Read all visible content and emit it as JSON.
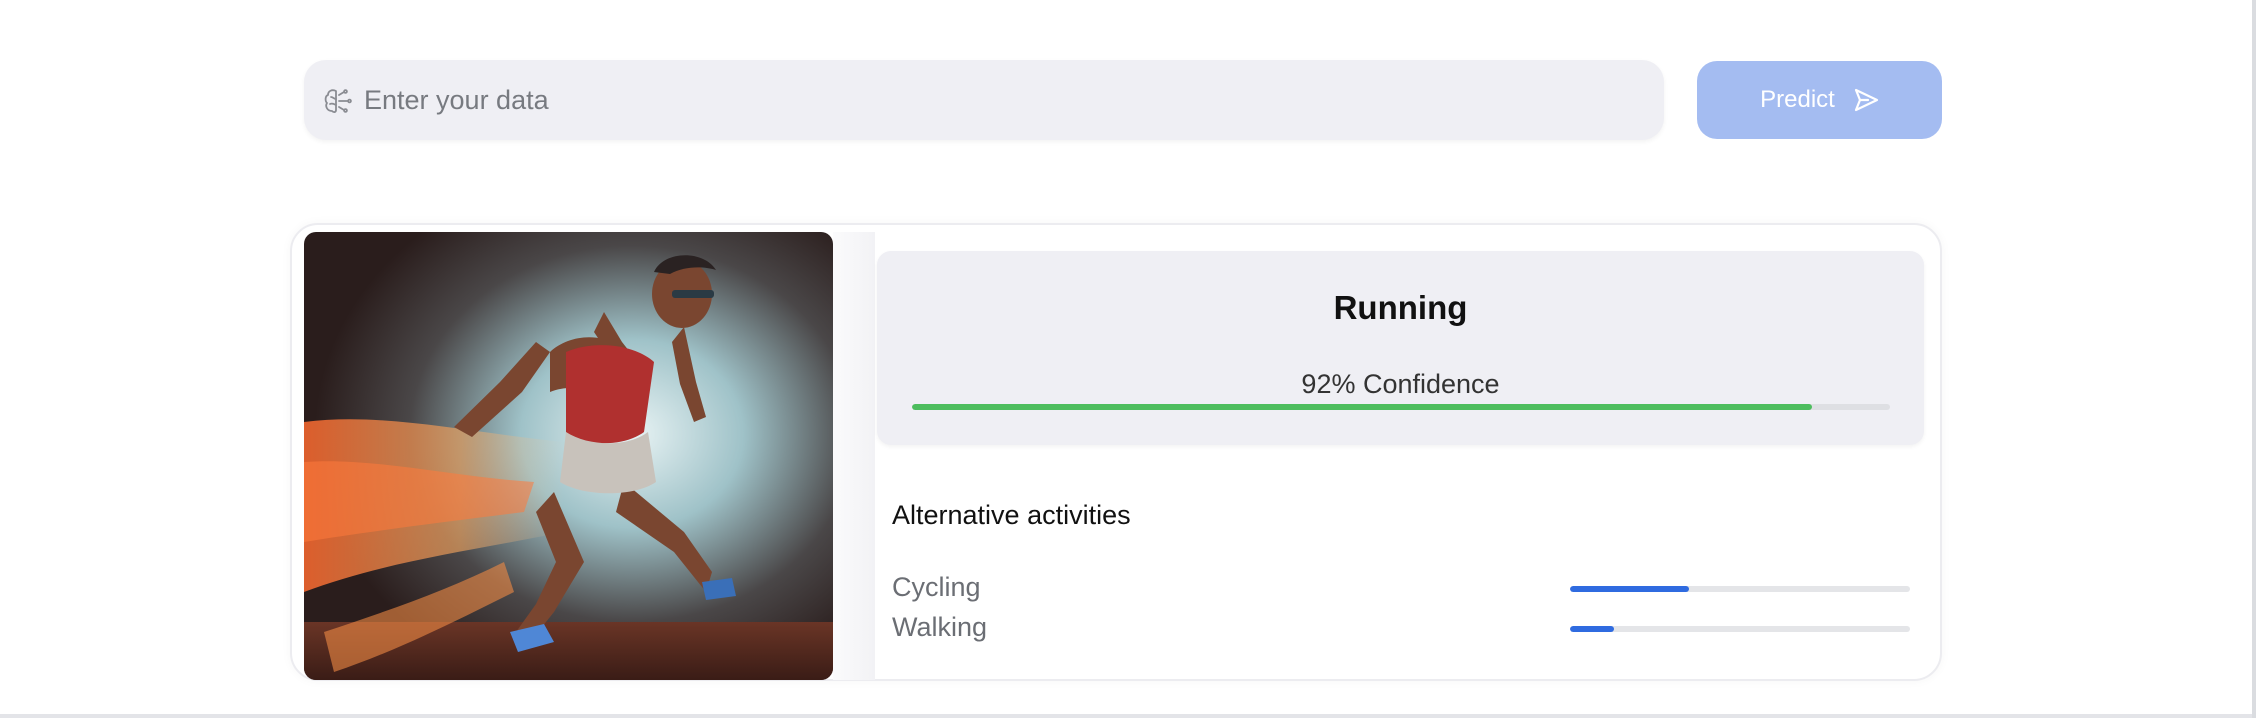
{
  "search": {
    "placeholder": "Enter your data",
    "value": "",
    "icon": "brain-icon"
  },
  "predict_button": {
    "label": "Predict",
    "icon": "send-icon",
    "color": "#a4bcf1"
  },
  "result": {
    "image": "runner-photo",
    "activity": "Running",
    "confidence_label": "92% Confidence",
    "confidence": 0.92,
    "bar_color": "#4dbd5e"
  },
  "alternatives": {
    "heading": "Alternative activities",
    "bar_color": "#2f6be0",
    "items": [
      {
        "label": "Cycling",
        "score": 0.35
      },
      {
        "label": "Walking",
        "score": 0.13
      }
    ]
  }
}
